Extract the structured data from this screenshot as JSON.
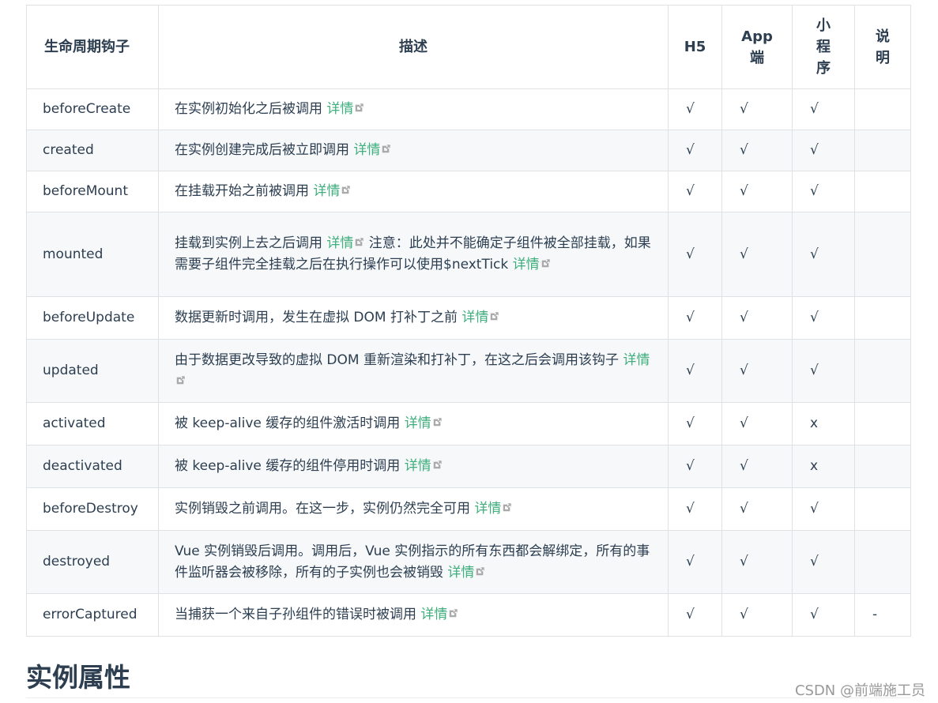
{
  "table": {
    "headers": [
      "生命周期钩子",
      "描述",
      "H5",
      "App端",
      "小程序",
      "说明"
    ],
    "link_text": "详情",
    "rows": [
      {
        "hook": "beforeCreate",
        "desc_pre": "在实例初始化之后被调用 ",
        "desc_post": "",
        "h5": "√",
        "app": "√",
        "mp": "√",
        "note": ""
      },
      {
        "hook": "created",
        "desc_pre": "在实例创建完成后被立即调用 ",
        "desc_post": "",
        "h5": "√",
        "app": "√",
        "mp": "√",
        "note": ""
      },
      {
        "hook": "beforeMount",
        "desc_pre": "在挂载开始之前被调用 ",
        "desc_post": "",
        "h5": "√",
        "app": "√",
        "mp": "√",
        "note": ""
      },
      {
        "hook": "mounted",
        "desc_pre": "挂载到实例上去之后调用 ",
        "desc_post": " 注意：此处并不能确定子组件被全部挂载，如果需要子组件完全挂载之后在执行操作可以使用$nextTick ",
        "desc_link2": true,
        "h5": "√",
        "app": "√",
        "mp": "√",
        "note": ""
      },
      {
        "hook": "beforeUpdate",
        "desc_pre": "数据更新时调用，发生在虚拟 DOM 打补丁之前 ",
        "desc_post": "",
        "h5": "√",
        "app": "√",
        "mp": "√",
        "note": ""
      },
      {
        "hook": "updated",
        "desc_pre": "由于数据更改导致的虚拟 DOM 重新渲染和打补丁，在这之后会调用该钩子 ",
        "desc_post": "",
        "h5": "√",
        "app": "√",
        "mp": "√",
        "note": ""
      },
      {
        "hook": "activated",
        "desc_pre": "被 keep-alive 缓存的组件激活时调用 ",
        "desc_post": "",
        "h5": "√",
        "app": "√",
        "mp": "x",
        "note": ""
      },
      {
        "hook": "deactivated",
        "desc_pre": "被 keep-alive 缓存的组件停用时调用 ",
        "desc_post": "",
        "h5": "√",
        "app": "√",
        "mp": "x",
        "note": ""
      },
      {
        "hook": "beforeDestroy",
        "desc_pre": "实例销毁之前调用。在这一步，实例仍然完全可用 ",
        "desc_post": "",
        "h5": "√",
        "app": "√",
        "mp": "√",
        "note": ""
      },
      {
        "hook": "destroyed",
        "desc_pre": "Vue 实例销毁后调用。调用后，Vue 实例指示的所有东西都会解绑定，所有的事件监听器会被移除，所有的子实例也会被销毁 ",
        "desc_post": "",
        "h5": "√",
        "app": "√",
        "mp": "√",
        "note": ""
      },
      {
        "hook": "errorCaptured",
        "desc_pre": "当捕获一个来自子孙组件的错误时被调用 ",
        "desc_post": "",
        "h5": "√",
        "app": "√",
        "mp": "√",
        "note": "-"
      }
    ]
  },
  "section_heading": "实例属性",
  "watermark": "CSDN @前端施工员",
  "colors": {
    "link": "#3eaf7c",
    "text": "#2c3e50",
    "border": "#dfe2e5",
    "stripe": "#f6f8fa"
  }
}
